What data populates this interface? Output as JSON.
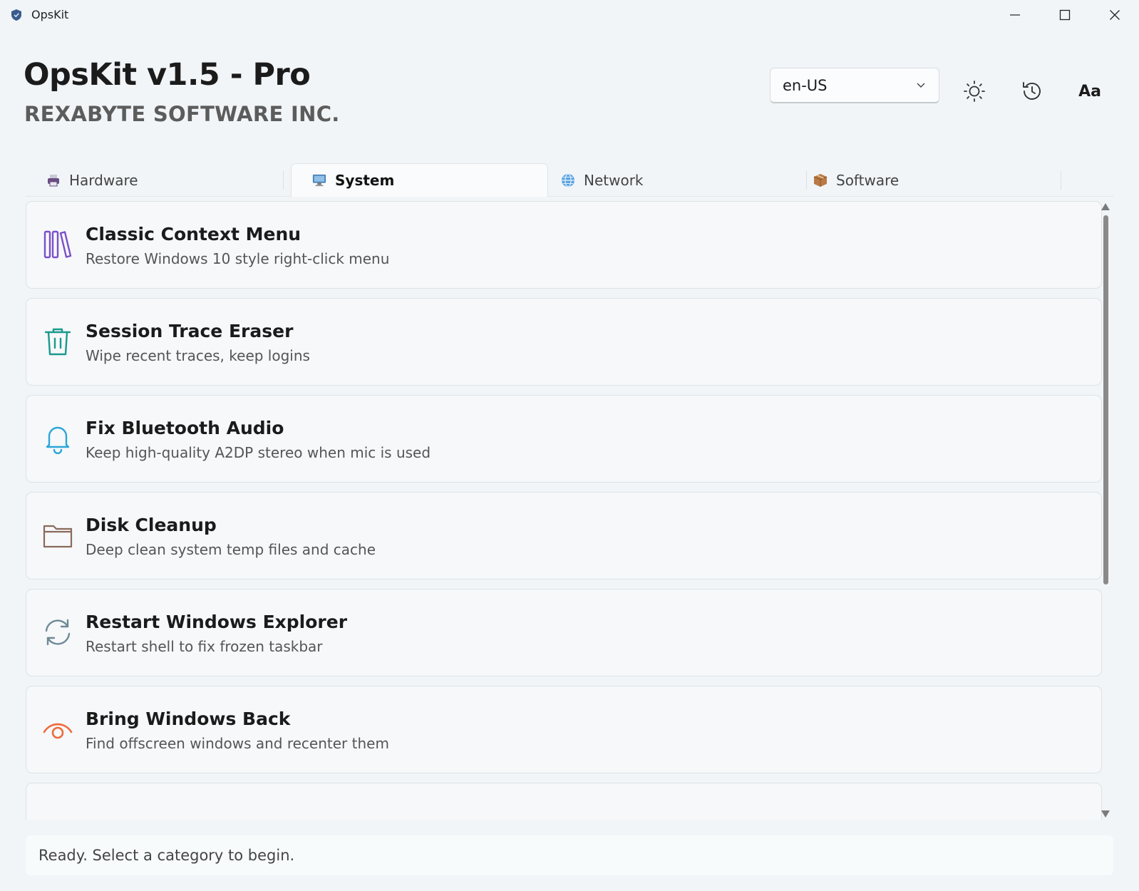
{
  "window": {
    "title": "OpsKit"
  },
  "header": {
    "app_name": "OpsKit v1.5 - Pro",
    "company": "REXABYTE SOFTWARE INC.",
    "language": "en-US",
    "font_button_label": "Aa"
  },
  "tabs": [
    {
      "label": "Hardware",
      "icon": "printer-icon",
      "active": false
    },
    {
      "label": "System",
      "icon": "monitor-icon",
      "active": true
    },
    {
      "label": "Network",
      "icon": "globe-icon",
      "active": false
    },
    {
      "label": "Software",
      "icon": "package-icon",
      "active": false
    }
  ],
  "tools": [
    {
      "title": "Classic Context Menu",
      "description": "Restore Windows 10 style right-click menu",
      "icon": "books-icon",
      "color": "#7b4fc9"
    },
    {
      "title": "Session Trace Eraser",
      "description": "Wipe recent traces, keep logins",
      "icon": "trash-icon",
      "color": "#1a9a8c"
    },
    {
      "title": "Fix Bluetooth Audio",
      "description": "Keep high-quality A2DP stereo when mic is used",
      "icon": "bell-icon",
      "color": "#2aa6d8"
    },
    {
      "title": "Disk Cleanup",
      "description": "Deep clean system temp files and cache",
      "icon": "folder-icon",
      "color": "#8a6a5a"
    },
    {
      "title": "Restart Windows Explorer",
      "description": "Restart shell to fix frozen taskbar",
      "icon": "refresh-icon",
      "color": "#6f8a96"
    },
    {
      "title": "Bring Windows Back",
      "description": "Find offscreen windows and recenter them",
      "icon": "eye-icon",
      "color": "#ef6a3a"
    }
  ],
  "status": {
    "text": "Ready. Select a category to begin."
  }
}
